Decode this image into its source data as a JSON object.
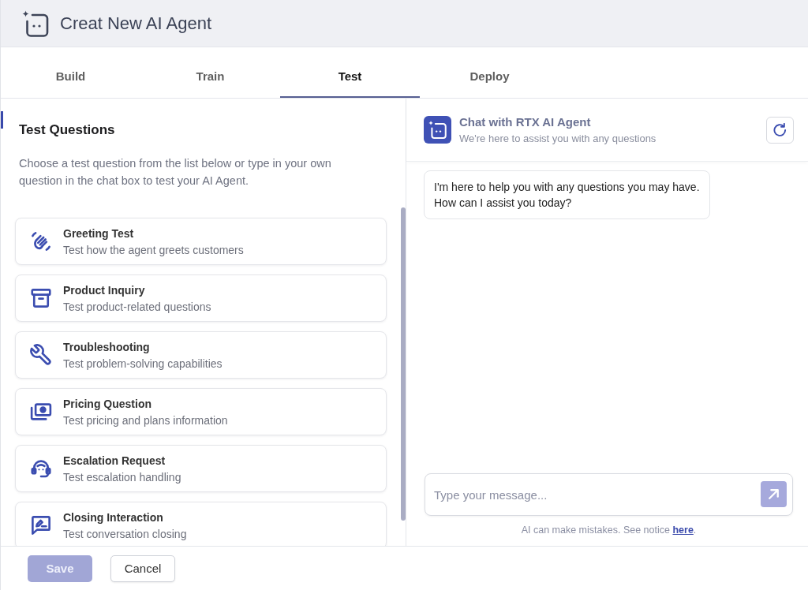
{
  "header": {
    "title": "Creat New AI Agent"
  },
  "tabs": [
    {
      "label": "Build",
      "selected": false
    },
    {
      "label": "Train",
      "selected": false
    },
    {
      "label": "Test",
      "selected": true
    },
    {
      "label": "Deploy",
      "selected": false
    }
  ],
  "test_questions": {
    "title": "Test Questions",
    "description": "Choose a test question from the list below or type in your own question in the chat box to test your AI Agent.",
    "items": [
      {
        "kind": "greeting",
        "title": "Greeting Test",
        "subtitle": "Test how the agent greets customers"
      },
      {
        "kind": "product",
        "title": "Product Inquiry",
        "subtitle": "Test product-related questions"
      },
      {
        "kind": "troubleshooting",
        "title": "Troubleshooting",
        "subtitle": "Test problem-solving capabilities"
      },
      {
        "kind": "pricing",
        "title": "Pricing Question",
        "subtitle": "Test pricing and plans information"
      },
      {
        "kind": "escalation",
        "title": "Escalation Request",
        "subtitle": "Test escalation handling"
      },
      {
        "kind": "closing",
        "title": "Closing Interaction",
        "subtitle": "Test conversation closing"
      }
    ]
  },
  "chat": {
    "title": "Chat with RTX AI Agent",
    "subtitle": "We're here to assist you with any questions",
    "messages": [
      {
        "text": "I'm here to help you with any questions you may have.\nHow can I assist you today?"
      }
    ],
    "input": {
      "placeholder": "Type your message..."
    },
    "send_button": {
      "disabled": true
    },
    "notice": {
      "text": "AI can make mistakes. See notice",
      "link": "here",
      "after": "."
    }
  },
  "footer": {
    "buttons": [
      {
        "kind": "primary",
        "label": "Save",
        "disabled": true
      },
      {
        "kind": "secondary",
        "label": "Cancel",
        "disabled": false
      }
    ]
  }
}
